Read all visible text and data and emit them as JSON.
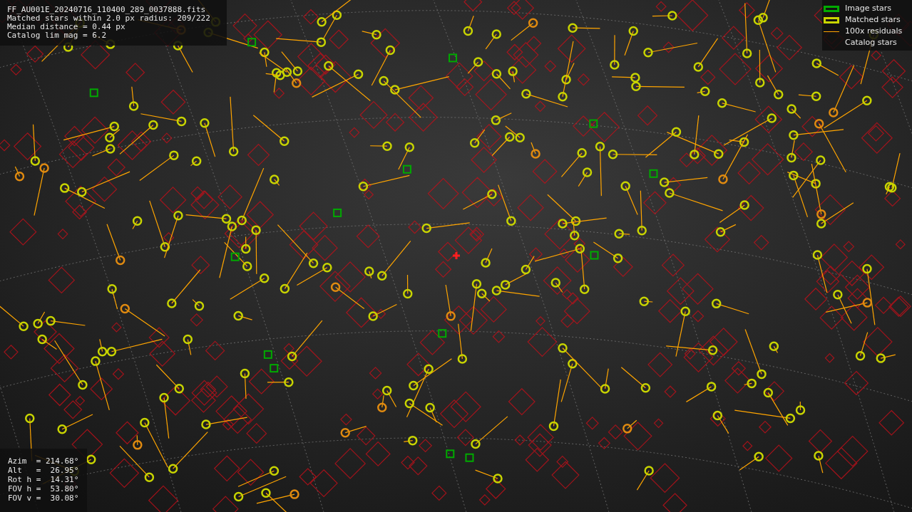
{
  "info": {
    "lines": [
      "FF_AU001E_20240716_110400_289_0037888.fits",
      "Matched stars within 2.0 px radius: 209/222",
      "Median distance = 0.44 px",
      "Catalog lim mag = 6.2"
    ]
  },
  "legend": [
    {
      "label": "Image stars",
      "kind": "box",
      "color": "#00aa00"
    },
    {
      "label": "Matched stars",
      "kind": "box",
      "color": "#c8d400"
    },
    {
      "label": "100x residuals",
      "kind": "line",
      "color": "#ffa500"
    },
    {
      "label": "Catalog stars",
      "kind": "none"
    }
  ],
  "pointing": {
    "lines": [
      "Azim  = 214.68°",
      "Alt   =  26.95°",
      "Rot h =  14.31°",
      "FOV h =  53.80°",
      "FOV v =  30.08°"
    ]
  }
}
